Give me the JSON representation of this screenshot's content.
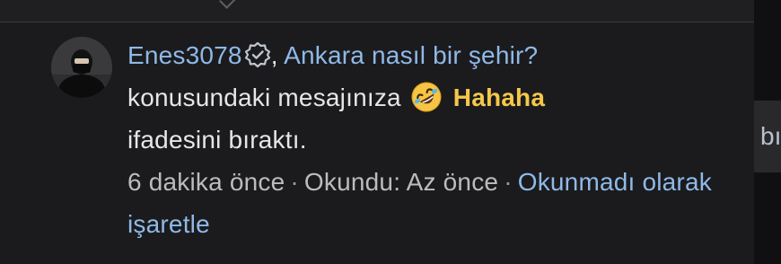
{
  "notification": {
    "username": "Enes3078",
    "verified_icon": "verified-badge-icon",
    "comma": ",",
    "thread_title": "Ankara nasıl bir şehir?",
    "text_before_reaction": "konusundaki mesajınıza",
    "reaction_emoji_icon": "rolling-on-floor-laughing-emoji",
    "reaction_name": "Hahaha",
    "text_after_reaction": "ifadesini bıraktı.",
    "time_ago": "6 dakika önce",
    "separator": "·",
    "read_status": "Okundu: Az önce",
    "mark_unread_label": "Okunmadı olarak işaretle"
  },
  "right_edge": {
    "partial_text": "bı"
  },
  "colors": {
    "background": "#1c1c1e",
    "link": "#8fb9e7",
    "reaction": "#f5c84b",
    "text": "#e6e6e6"
  }
}
